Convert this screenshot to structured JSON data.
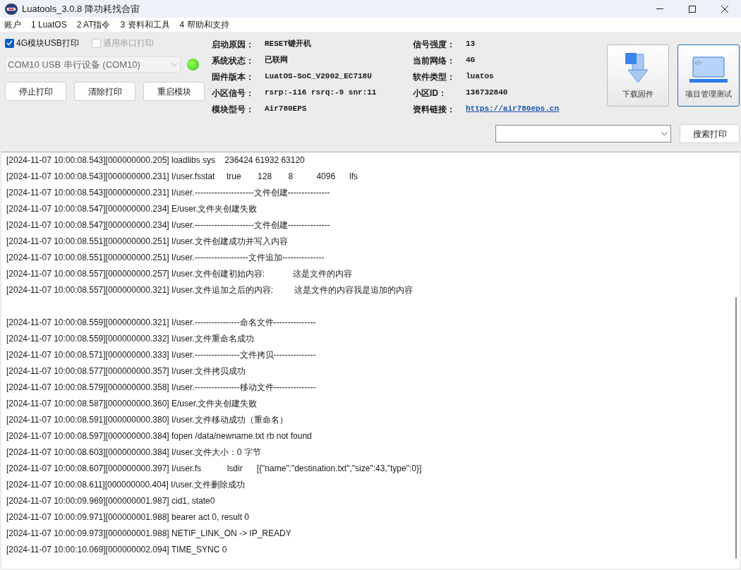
{
  "window": {
    "title": "Luatools_3.0.8 降功耗找合宙"
  },
  "menu": [
    "账户",
    "1 LuatOS",
    "2 AT指令",
    "3 资料和工具",
    "4 帮助和支持"
  ],
  "print_options": [
    {
      "label": "4G模块USB打印",
      "checked": true,
      "disabled": false
    },
    {
      "label": "通用串口打印",
      "checked": false,
      "disabled": true
    }
  ],
  "port_select": {
    "value": "COM10 USB 串行设备 (COM10)",
    "disabled": true,
    "connected": true
  },
  "buttons": [
    "停止打印",
    "清除打印",
    "重启模块"
  ],
  "info_left": [
    {
      "label": "启动原因：",
      "value": "RESET键开机"
    },
    {
      "label": "系统状态：",
      "value": "已联网"
    },
    {
      "label": "固件版本：",
      "value": "LuatOS-SoC_V2002_EC718U"
    },
    {
      "label": "小区信号：",
      "value": "rsrp:-116 rsrq:-9 snr:11"
    },
    {
      "label": "模块型号：",
      "value": "Air780EPS"
    }
  ],
  "info_right": [
    {
      "label": "信号强度：",
      "value": "13",
      "kind": "text"
    },
    {
      "label": "当前网络：",
      "value": "4G",
      "kind": "text"
    },
    {
      "label": "软件类型：",
      "value": "luatos",
      "kind": "text"
    },
    {
      "label": "小区ID：",
      "value": "136732840",
      "kind": "text"
    },
    {
      "label": "资料链接：",
      "value": "https://air780eps.cn",
      "kind": "link"
    }
  ],
  "tool_buttons": [
    {
      "label": "下载固件",
      "kind": "download",
      "selected": false
    },
    {
      "label": "项目管理测试",
      "kind": "project",
      "selected": true
    }
  ],
  "search_button": "搜索打印",
  "log": [
    {
      "text": "[2024-11-07 10:00:08.543][000000000.205] loadlibs sys    236424 61932 63120",
      "blank_before": false
    },
    {
      "text": "[2024-11-07 10:00:08.543][000000000.231] I/user.fsstat     true       128       8          4096      lfs",
      "blank_before": false
    },
    {
      "text": "[2024-11-07 10:00:08.543][000000000.231] I/user.---------------------文件创建---------------",
      "blank_before": false
    },
    {
      "text": "[2024-11-07 10:00:08.547][000000000.234] E/user.文件夹创建失败",
      "blank_before": false
    },
    {
      "text": "[2024-11-07 10:00:08.547][000000000.234] I/user.---------------------文件创建---------------",
      "blank_before": false
    },
    {
      "text": "[2024-11-07 10:00:08.551][000000000.251] I/user.文件创建成功并写入内容",
      "blank_before": false
    },
    {
      "text": "[2024-11-07 10:00:08.551][000000000.251] I/user.-------------------文件追加---------------",
      "blank_before": false
    },
    {
      "text": "[2024-11-07 10:00:08.557][000000000.257] I/user.文件创建初始内容:            这是文件的内容",
      "blank_before": false
    },
    {
      "text": "[2024-11-07 10:00:08.557][000000000.321] I/user.文件追加之后的内容:         这是文件的内容我是追加的内容",
      "blank_before": false
    },
    {
      "text": "[2024-11-07 10:00:08.559][000000000.321] I/user.----------------命名文件---------------",
      "blank_before": true
    },
    {
      "text": "[2024-11-07 10:00:08.559][000000000.332] I/user.文件重命名成功",
      "blank_before": false
    },
    {
      "text": "[2024-11-07 10:00:08.571][000000000.333] I/user.----------------文件拷贝---------------",
      "blank_before": false
    },
    {
      "text": "[2024-11-07 10:00:08.577][000000000.357] I/user.文件拷贝成功",
      "blank_before": false
    },
    {
      "text": "[2024-11-07 10:00:08.579][000000000.358] I/user.----------------移动文件---------------",
      "blank_before": false
    },
    {
      "text": "[2024-11-07 10:00:08.587][000000000.360] E/user.文件夹创建失败",
      "blank_before": false
    },
    {
      "text": "[2024-11-07 10:00:08.591][000000000.380] I/user.文件移动成功（重命名）",
      "blank_before": false
    },
    {
      "text": "[2024-11-07 10:00:08.597][000000000.384] fopen /data/newname.txt rb not found",
      "blank_before": false
    },
    {
      "text": "[2024-11-07 10:00:08.603][000000000.384] I/user.文件大小：0 字节",
      "blank_before": false
    },
    {
      "text": "[2024-11-07 10:00:08.607][000000000.397] I/user.fs           lsdir      [{\"name\":\"destination.txt\",\"size\":43,\"type\":0}]",
      "blank_before": false
    },
    {
      "text": "[2024-11-07 10:00:08.611][000000000.404] I/user.文件删除成功",
      "blank_before": false
    },
    {
      "text": "[2024-11-07 10:00:09.969][000000001.987] cid1, state0",
      "blank_before": false
    },
    {
      "text": "[2024-11-07 10:00:09.971][000000001.988] bearer act 0, result 0",
      "blank_before": false
    },
    {
      "text": "[2024-11-07 10:00:09.973][000000001.988] NETIF_LINK_ON -> IP_READY",
      "blank_before": false
    },
    {
      "text": "[2024-11-07 10:00:10.069][000000002.094] TIME_SYNC 0",
      "blank_before": false
    }
  ]
}
